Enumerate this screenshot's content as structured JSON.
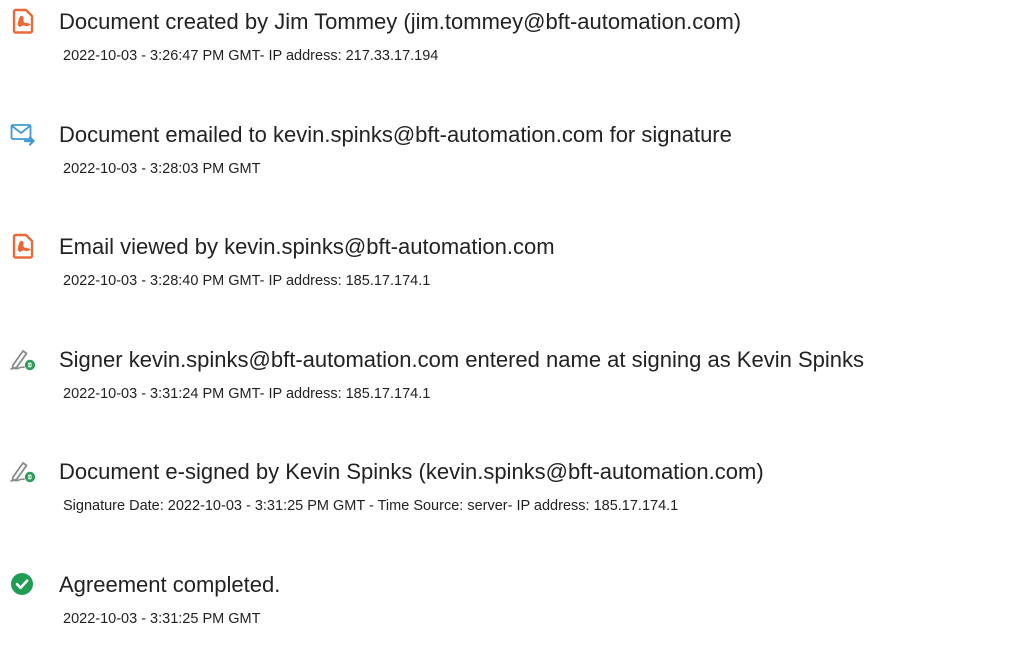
{
  "audit_events": [
    {
      "icon": "pdf-document-icon",
      "title": "Document created by Jim Tommey (jim.tommey@bft-automation.com)",
      "detail": "2022-10-03 - 3:26:47 PM GMT- IP address: 217.33.17.194"
    },
    {
      "icon": "email-sent-icon",
      "title": "Document emailed to kevin.spinks@bft-automation.com for signature",
      "detail": "2022-10-03 - 3:28:03 PM GMT"
    },
    {
      "icon": "pdf-document-icon",
      "title": "Email viewed by kevin.spinks@bft-automation.com",
      "detail": "2022-10-03 - 3:28:40 PM GMT- IP address: 185.17.174.1"
    },
    {
      "icon": "signature-pen-icon",
      "title": "Signer kevin.spinks@bft-automation.com entered name at signing as Kevin Spinks",
      "detail": "2022-10-03 - 3:31:24 PM GMT- IP address: 185.17.174.1"
    },
    {
      "icon": "signature-pen-icon",
      "title": "Document e-signed by Kevin Spinks (kevin.spinks@bft-automation.com)",
      "detail": "Signature Date: 2022-10-03 - 3:31:25 PM GMT - Time Source: server- IP address: 185.17.174.1"
    },
    {
      "icon": "check-circle-icon",
      "title": "Agreement completed.",
      "detail": "2022-10-03 - 3:31:25 PM GMT"
    }
  ],
  "colors": {
    "pdf_icon": "#e8693a",
    "email_icon": "#3d9ad6",
    "pen_icon": "#8a8a8a",
    "pen_badge": "#2f9e5c",
    "check_icon": "#1f9d55",
    "text": "#222222"
  }
}
